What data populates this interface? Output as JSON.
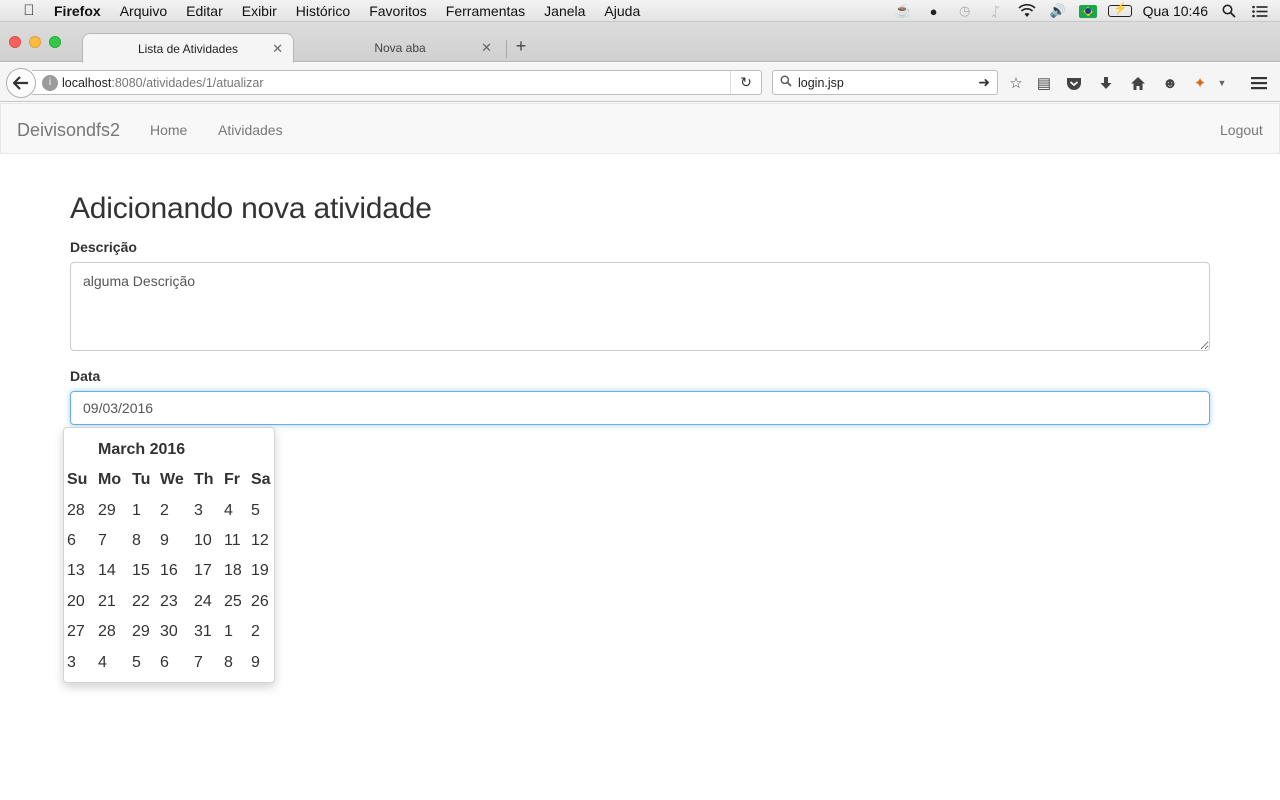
{
  "menubar": {
    "app": "Firefox",
    "items": [
      "Arquivo",
      "Editar",
      "Exibir",
      "Histórico",
      "Favoritos",
      "Ferramentas",
      "Janela",
      "Ajuda"
    ],
    "clock": "Qua 10:46"
  },
  "tabs": [
    {
      "label": "Lista de Atividades",
      "active": true
    },
    {
      "label": "Nova aba",
      "active": false
    }
  ],
  "toolbar": {
    "url_host": "localhost",
    "url_path": ":8080/atividades/1/atualizar",
    "search_value": "login.jsp"
  },
  "site_nav": {
    "brand": "Deivisondfs2",
    "links": [
      "Home",
      "Atividades"
    ],
    "logout": "Logout"
  },
  "form": {
    "title": "Adicionando nova atividade",
    "description_label": "Descrição",
    "description_value": "alguma Descrição",
    "date_label": "Data",
    "date_value": "09/03/2016"
  },
  "datepicker": {
    "month_title": "March 2016",
    "weekdays": [
      "Su",
      "Mo",
      "Tu",
      "We",
      "Th",
      "Fr",
      "Sa"
    ],
    "weeks": [
      [
        "28",
        "29",
        "1",
        "2",
        "3",
        "4",
        "5"
      ],
      [
        "6",
        "7",
        "8",
        "9",
        "10",
        "11",
        "12"
      ],
      [
        "13",
        "14",
        "15",
        "16",
        "17",
        "18",
        "19"
      ],
      [
        "20",
        "21",
        "22",
        "23",
        "24",
        "25",
        "26"
      ],
      [
        "27",
        "28",
        "29",
        "30",
        "31",
        "1",
        "2"
      ],
      [
        "3",
        "4",
        "5",
        "6",
        "7",
        "8",
        "9"
      ]
    ]
  },
  "colors": {
    "focus_border": "#66afe9",
    "nav_bg": "#f8f8f8",
    "link_color": "#777777"
  }
}
